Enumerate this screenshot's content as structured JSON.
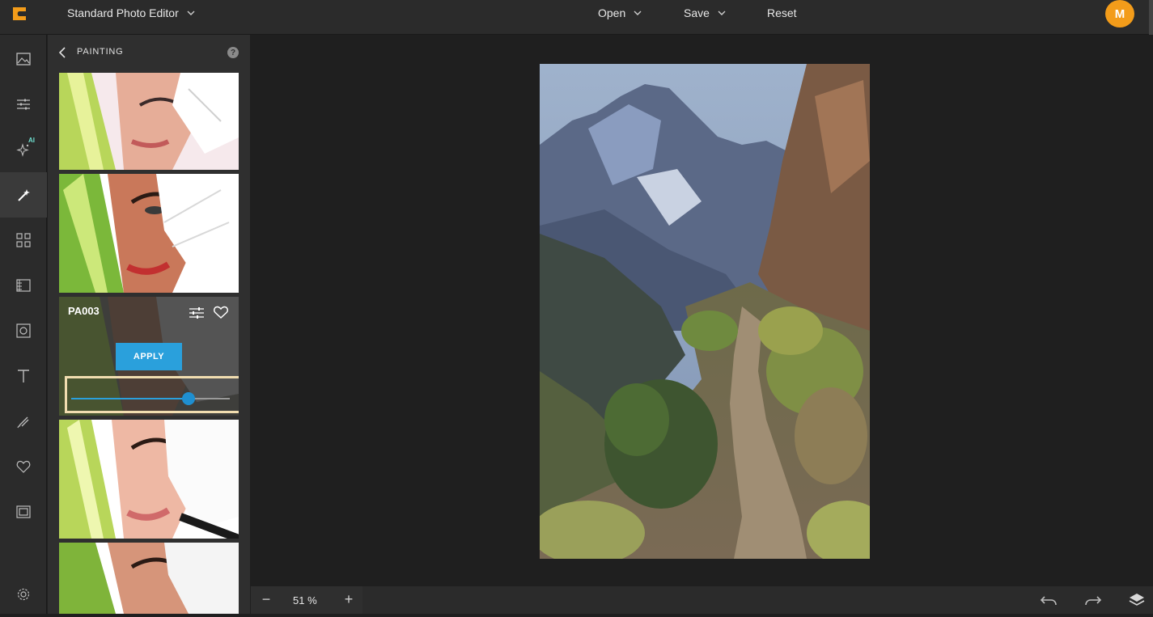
{
  "header": {
    "app_title": "Standard Photo Editor",
    "menus": [
      {
        "label": "Open"
      },
      {
        "label": "Save"
      },
      {
        "label": "Reset"
      }
    ],
    "avatar_initial": "M",
    "accent_color": "#f39c1a"
  },
  "rail": {
    "items": [
      {
        "icon": "image-icon"
      },
      {
        "icon": "sliders-icon"
      },
      {
        "icon": "ai-sparkle-icon",
        "badge": "AI"
      },
      {
        "icon": "magic-wand-icon",
        "active": true
      },
      {
        "icon": "grid-icon"
      },
      {
        "icon": "texture-icon"
      },
      {
        "icon": "frame-icon"
      },
      {
        "icon": "text-icon"
      },
      {
        "icon": "brush-icon"
      },
      {
        "icon": "heart-icon"
      },
      {
        "icon": "border-icon"
      },
      {
        "icon": "settings-icon"
      }
    ]
  },
  "panel": {
    "title": "PAINTING",
    "help": "?",
    "selected_effect": {
      "name": "PA003",
      "apply_label": "APPLY",
      "intensity": 0.74
    }
  },
  "bottom": {
    "zoom_minus": "−",
    "zoom_value": "51 %",
    "zoom_plus": "+"
  },
  "colors": {
    "apply_button": "#2aa0dc",
    "highlight_border": "#f1ddb0"
  }
}
